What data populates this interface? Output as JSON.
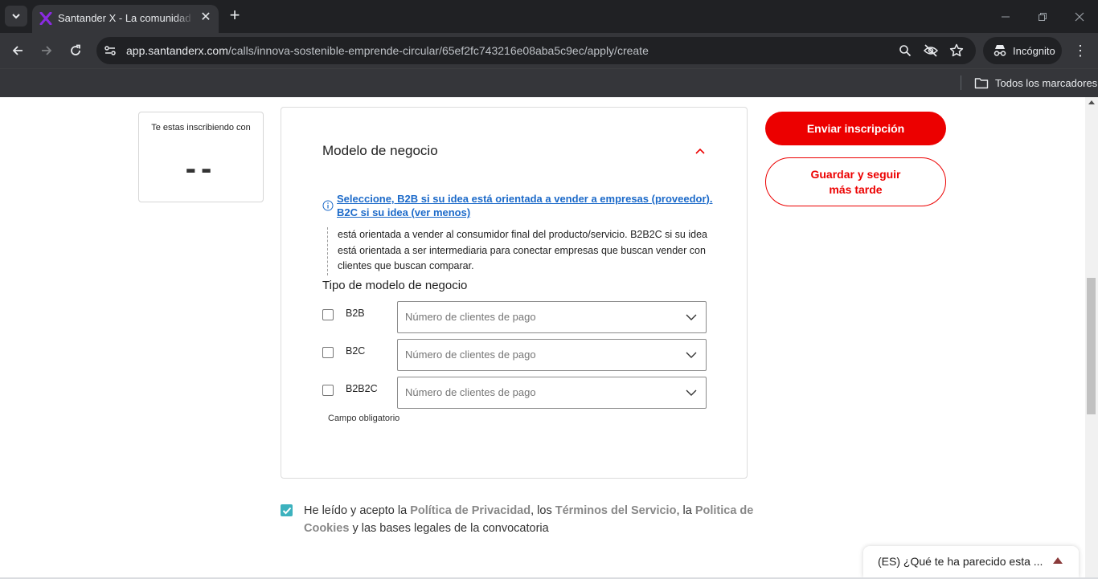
{
  "browser": {
    "tab_title": "Santander X - La comunidad global",
    "url_domain": "app.santanderx.com",
    "url_path": "/calls/innova-sostenible-emprende-circular/65ef2fc743216e08aba5c9ec/apply/create",
    "incognito_label": "Incógnito",
    "bookmarks_label": "Todos los marcadores"
  },
  "enrollment": {
    "label": "Te estas inscribiendo con",
    "value": "--"
  },
  "section": {
    "title": "Modelo de negocio",
    "info_link": "Seleccione, B2B si su idea está orientada a vender a empresas (proveedor). B2C si su idea (ver menos)",
    "info_body": "está orientada a vender al consumidor final del producto/servicio. B2B2C si su idea está orientada a ser intermediaria para conectar empresas que buscan vender con clientes que buscan comparar.",
    "type_label": "Tipo de modelo de negocio",
    "options": [
      {
        "label": "B2B",
        "placeholder": "Número de clientes de pago"
      },
      {
        "label": "B2C",
        "placeholder": "Número de clientes de pago"
      },
      {
        "label": "B2B2C",
        "placeholder": "Número de clientes de pago"
      }
    ],
    "required_note": "Campo obligatorio"
  },
  "actions": {
    "submit": "Enviar inscripción",
    "save_later": "Guardar y seguir más tarde"
  },
  "consent": {
    "t1": "He leído y acepto la ",
    "privacy": "Política de Privacidad",
    "t2": ", los ",
    "terms": "Términos del Servicio",
    "t3": ", la ",
    "cookies": "Politica de Cookies",
    "t4": " y las bases legales de la convocatoria"
  },
  "feedback": {
    "label": "(ES) ¿Qué te ha parecido esta ..."
  },
  "colors": {
    "brand_red": "#ec0000",
    "link_blue": "#1c6ac9",
    "checkbox_teal": "#3cb2be"
  }
}
